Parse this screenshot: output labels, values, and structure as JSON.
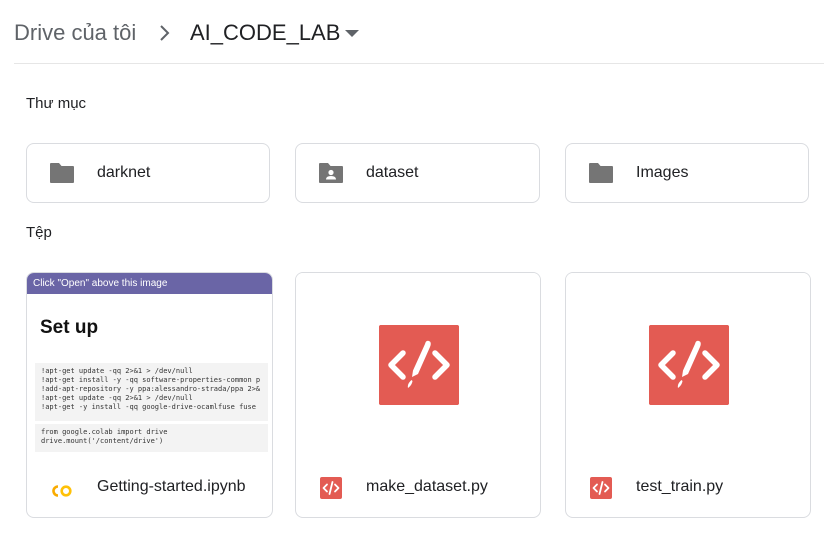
{
  "breadcrumb": {
    "root": "Drive của tôi",
    "current": "AI_CODE_LAB"
  },
  "sections": {
    "folders_title": "Thư mục",
    "files_title": "Tệp"
  },
  "folders": [
    {
      "name": "darknet",
      "icon": "folder-icon"
    },
    {
      "name": "dataset",
      "icon": "shared-folder-icon"
    },
    {
      "name": "Images",
      "icon": "folder-icon"
    }
  ],
  "files": [
    {
      "name": "Getting-started.ipynb",
      "icon": "colab-icon",
      "preview": {
        "banner": "Click \"Open\" above this image",
        "heading": "Set up",
        "code1": [
          "!apt-get update -qq 2>&1 > /dev/null",
          "!apt-get install -y -qq software-properties-common p",
          "!add-apt-repository -y ppa:alessandro-strada/ppa 2>&",
          "!apt-get update -qq 2>&1 > /dev/null",
          "!apt-get -y install -qq google-drive-ocamlfuse fuse"
        ],
        "code2": [
          "from google.colab import drive",
          "drive.mount('/content/drive')"
        ]
      }
    },
    {
      "name": "make_dataset.py",
      "icon": "code-file-icon"
    },
    {
      "name": "test_train.py",
      "icon": "code-file-icon"
    }
  ],
  "colors": {
    "folder_gray": "#757575",
    "code_red": "#e35b53",
    "colab_orange": "#f9ab00",
    "colab_yellow": "#ffc107",
    "banner_purple": "#6a65a6",
    "border": "#dadce0"
  }
}
